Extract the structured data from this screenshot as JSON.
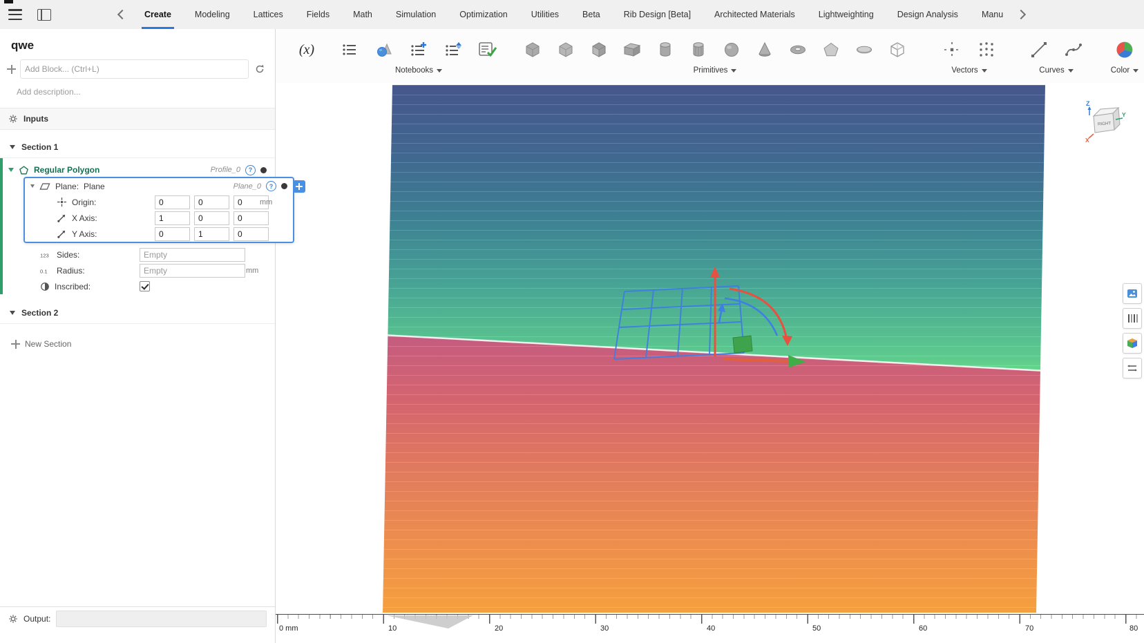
{
  "topbar": {
    "tabs": [
      "Create",
      "Modeling",
      "Lattices",
      "Fields",
      "Math",
      "Simulation",
      "Optimization",
      "Utilities",
      "Beta",
      "Rib Design [Beta]",
      "Architected Materials",
      "Lightweighting",
      "Design Analysis",
      "Manu"
    ],
    "active_tab": "Create"
  },
  "sidebar": {
    "title": "qwe",
    "add_block_placeholder": "Add Block... (Ctrl+L)",
    "description_placeholder": "Add description...",
    "inputs_label": "Inputs",
    "section_1_label": "Section 1",
    "section_2_label": "Section 2",
    "new_section_label": "New Section",
    "output_label": "Output:",
    "block": {
      "name": "Regular Polygon",
      "badge": "Profile_0",
      "rows": {
        "plane": {
          "label": "Plane:",
          "value": "Plane",
          "badge": "Plane_0"
        },
        "origin": {
          "label": "Origin:",
          "values": [
            "0",
            "0",
            "0"
          ],
          "unit": "mm"
        },
        "x_axis": {
          "label": "X Axis:",
          "values": [
            "1",
            "0",
            "0"
          ]
        },
        "y_axis": {
          "label": "Y Axis:",
          "values": [
            "0",
            "1",
            "0"
          ]
        },
        "sides": {
          "label": "Sides:",
          "placeholder": "Empty"
        },
        "radius": {
          "label": "Radius:",
          "placeholder": "Empty",
          "unit": "mm"
        },
        "inscribed": {
          "label": "Inscribed:",
          "checked": true
        }
      }
    }
  },
  "toolbar": {
    "notebooks_label": "Notebooks",
    "primitives_label": "Primitives",
    "vectors_label": "Vectors",
    "curves_label": "Curves",
    "color_label": "Color"
  },
  "viewport": {
    "viewcube": {
      "face": "RIGHT",
      "axis_x": "X",
      "axis_y": "Y",
      "axis_z": "Z"
    },
    "ruler": {
      "labels": [
        "0 mm",
        "10",
        "20",
        "30",
        "40",
        "50",
        "60",
        "70",
        "80"
      ]
    }
  },
  "icons": {
    "function": "(x)",
    "help": "?",
    "sides": "123",
    "radius": "0.1"
  },
  "colors": {
    "accent_blue": "#4a90e2",
    "active_tab_underline": "#2779e0",
    "block_green": "#2f9e68",
    "block_name_text": "#156f52",
    "gradient_top_blue": "#46568c",
    "gradient_green": "#5ecb8d",
    "gradient_pink": "#c45c80",
    "gradient_orange": "#f5a03e"
  }
}
